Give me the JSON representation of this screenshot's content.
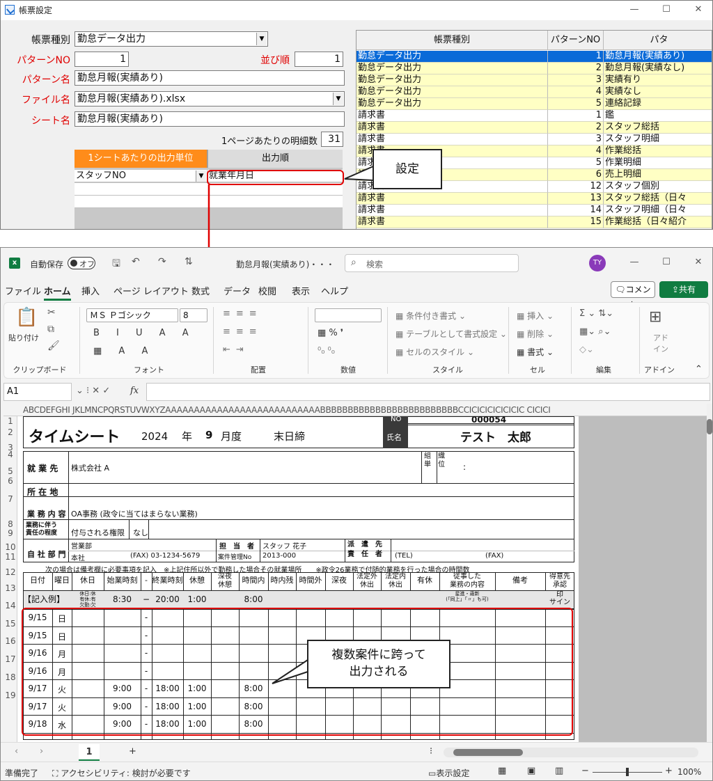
{
  "form_window": {
    "title": "帳票設定",
    "labels": {
      "report_type": "帳票種別",
      "pattern_no": "パターンNO",
      "order": "並び順",
      "pattern_name": "パターン名",
      "file_name": "ファイル名",
      "sheet_name": "シート名",
      "rows_per_page": "1ページあたりの明細数"
    },
    "values": {
      "report_type": "勤怠データ出力",
      "pattern_no": "1",
      "order": "1",
      "pattern_name": "勤怠月報(実績あり)",
      "file_name": "勤怠月報(実績あり).xlsx",
      "sheet_name": "勤怠月報(実績あり)",
      "rows_per_page": "31"
    },
    "output_grid": {
      "col_unit": "1シートあたりの出力単位",
      "col_order": "出力順",
      "unit_value": "スタッフNO",
      "order_value": "就業年月日"
    },
    "list": {
      "headers": [
        "帳票種別",
        "パターンNO",
        "パタ"
      ],
      "rows": [
        {
          "type": "勤怠データ出力",
          "no": "1",
          "name": "勤怠月報(実績あり)"
        },
        {
          "type": "勤怠データ出力",
          "no": "2",
          "name": "勤怠月報(実績なし)"
        },
        {
          "type": "勤怠データ出力",
          "no": "3",
          "name": "実績有り"
        },
        {
          "type": "勤怠データ出力",
          "no": "4",
          "name": "実績なし"
        },
        {
          "type": "勤怠データ出力",
          "no": "5",
          "name": "連絡記録"
        },
        {
          "type": "請求書",
          "no": "1",
          "name": "鑑"
        },
        {
          "type": "請求書",
          "no": "2",
          "name": "スタッフ総括"
        },
        {
          "type": "請求書",
          "no": "3",
          "name": "スタッフ明細"
        },
        {
          "type": "請求書",
          "no": "4",
          "name": "作業総括"
        },
        {
          "type": "請求書",
          "no": "5",
          "name": "作業明細"
        },
        {
          "type": "請求書",
          "no": "6",
          "name": "売上明細"
        },
        {
          "type": "請求書",
          "no": "12",
          "name": "スタッフ個別"
        },
        {
          "type": "請求書",
          "no": "13",
          "name": "スタッフ総括（日々"
        },
        {
          "type": "請求書",
          "no": "14",
          "name": "スタッフ明細（日々"
        },
        {
          "type": "請求書",
          "no": "15",
          "name": "作業総括（日々紹介"
        }
      ]
    },
    "callout_setting": "設定"
  },
  "excel": {
    "autosave": "自動保存",
    "autosave_state": "オフ",
    "doc_title": "勤怠月報(実績あり)・・・",
    "search": "検索",
    "avatar": "TY",
    "tabs": [
      "ファイル",
      "ホーム",
      "挿入",
      "ページ レイアウト",
      "数式",
      "データ",
      "校閲",
      "表示",
      "ヘルプ"
    ],
    "comment": "コメント",
    "share": "共有",
    "ribbon": {
      "paste": "貼り付け",
      "font_name": "ＭＳ Ｐゴシック",
      "font_size": "8",
      "cond_format": "条件付き書式",
      "table_format": "テーブルとして書式設定",
      "cell_style": "セルのスタイル",
      "insert": "挿入",
      "delete": "削除",
      "format": "書式",
      "addin": "アド\nイン",
      "groups": [
        "クリップボード",
        "フォント",
        "配置",
        "数値",
        "スタイル",
        "セル",
        "編集",
        "アドイン"
      ]
    },
    "name_box": "A1",
    "fx": "fx",
    "col_headers": "ABCDEFGHI JKLMNCPQRSTUVWXYZAAAAAAAAAAAAAAAAAAAAAAAAAAABBBBBBBBBBBBBBBBBBBBBBBBBCCICICICICICICIC CICICI",
    "sheet": {
      "no_label": "NO",
      "no_value": "000054",
      "name_label": "氏名",
      "name_value": "テスト　太郎",
      "title": "タイムシート",
      "year": "2024",
      "year_unit": "年",
      "month": "9",
      "month_unit": "月度",
      "closing": "末日締",
      "company_label": "就 業 先",
      "company": "株式会社 A",
      "org_label": "組　織\n単　位",
      "org_value": ":",
      "address_label": "所 在 地",
      "work_label": "業 務 内 容",
      "work": "OA事務 (政令に当てはまらない業務)",
      "duty_label": "業務に伴う\n責任の程度",
      "duty_sub": "付与される権限",
      "duty_value": "なし",
      "dept_label": "自 社 部 門",
      "dept": "営業部",
      "office": "本社",
      "fax1": "(FAX) 03-1234-5679",
      "manager_label": "担　当　者",
      "manager": "スタッフ 花子",
      "case_label": "案件管理No",
      "case_no": "2013-000",
      "dispatch_label": "派　遣　先\n責　任　者",
      "tel": "(TEL)",
      "fax2": "(FAX)",
      "note": "次の場合は備考欄に必要事項を記入　※上記住所以外で勤務した場合その就業場所　　※政令26業務で付随的業務を行った場合の時間数",
      "headers": [
        "日付",
        "曜日",
        "休日",
        "始業時刻",
        "-",
        "終業時刻",
        "休憩",
        "深夜\n休憩",
        "時間内",
        "時内残",
        "時間外",
        "深夜",
        "法定外\n休出",
        "法定内\n休出",
        "有休",
        "従事した\n業務の内容",
        "備考",
        "得意先\n承認"
      ],
      "example": [
        "【記入例】",
        "",
        "休日:休\n有休:有\n欠勤:欠",
        "8:30",
        "−",
        "20:00",
        "1:00",
        "",
        "8:00",
        "",
        "",
        "",
        "",
        "",
        "",
        "星進・歳新\n(「同上」「〃」も可)",
        "",
        "印\nサイン"
      ],
      "rows": [
        {
          "date": "9/15",
          "dow": "日",
          "start": "",
          "end": "",
          "break": "",
          "in": ""
        },
        {
          "date": "9/15",
          "dow": "日",
          "start": "",
          "end": "",
          "break": "",
          "in": ""
        },
        {
          "date": "9/16",
          "dow": "月",
          "start": "",
          "end": "",
          "break": "",
          "in": ""
        },
        {
          "date": "9/16",
          "dow": "月",
          "start": "",
          "end": "",
          "break": "",
          "in": ""
        },
        {
          "date": "9/17",
          "dow": "火",
          "start": "9:00",
          "end": "18:00",
          "break": "1:00",
          "in": "8:00"
        },
        {
          "date": "9/17",
          "dow": "火",
          "start": "9:00",
          "end": "18:00",
          "break": "1:00",
          "in": "8:00"
        },
        {
          "date": "9/18",
          "dow": "水",
          "start": "9:00",
          "end": "18:00",
          "break": "1:00",
          "in": "8:00"
        }
      ],
      "row_numbers": [
        "1",
        "2",
        "3",
        "4",
        "5",
        "6",
        "7",
        "8",
        "9",
        "10",
        "11",
        "12",
        "13",
        "14",
        "15",
        "16",
        "17",
        "18",
        "19"
      ]
    },
    "callout_multi": "複数案件に跨って\n出力される",
    "sheet_tab": "1",
    "status_ready": "準備完了",
    "status_access": "アクセシビリティ: 検討が必要です",
    "view_settings": "表示設定",
    "zoom": "100%"
  },
  "colors": {
    "accent_red": "#e00000",
    "excel_green": "#107c41",
    "orange": "#ff8c1a",
    "selected_blue": "#0a6ad8",
    "row_yellow": "#ffffc4"
  }
}
